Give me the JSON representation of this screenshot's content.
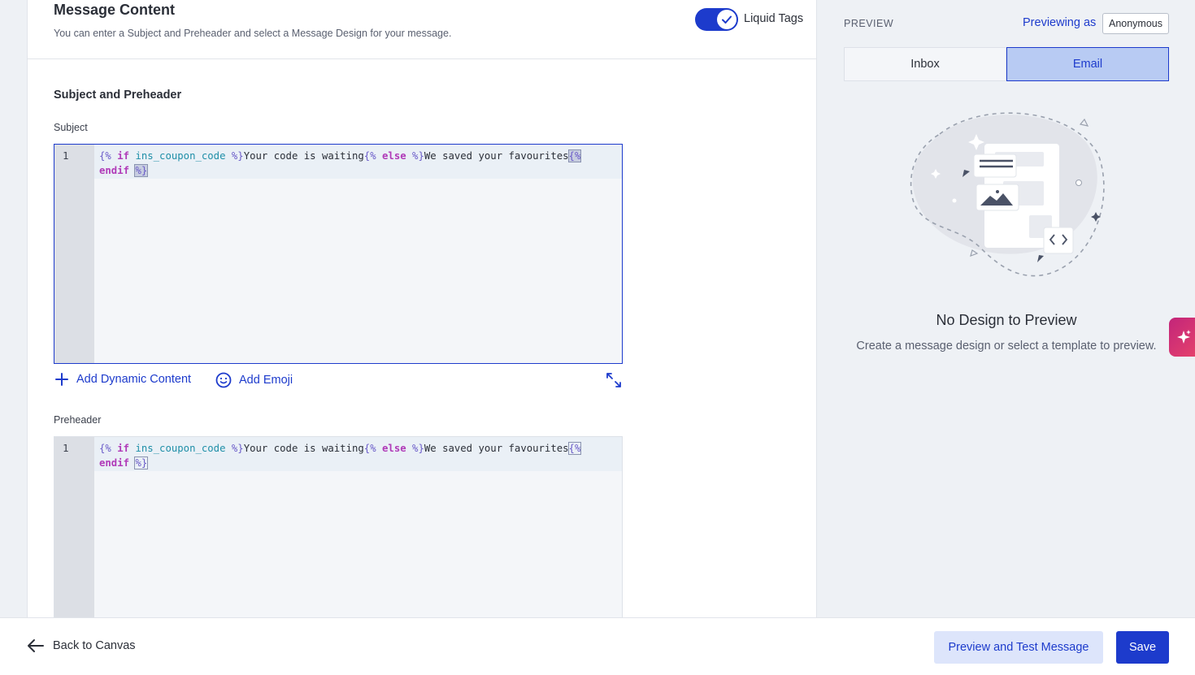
{
  "header": {
    "title": "Message Content",
    "subtitle": "You can enter a Subject and Preheader and select a Message Design for your message.",
    "liquid_toggle_label": "Liquid Tags",
    "liquid_toggle_on": true
  },
  "subject_section": {
    "title": "Subject and Preheader",
    "subject_label": "Subject",
    "preheader_label": "Preheader"
  },
  "code": {
    "line_number": "1",
    "open_if": "{%",
    "kw_if": "if",
    "var": "ins_coupon_code",
    "close": "%}",
    "text_a": "Your code is waiting",
    "open_else": "{%",
    "kw_else": "else",
    "close_else": "%}",
    "text_b": "We saved your favourites",
    "open_endif": "{%",
    "kw_endif": "endif",
    "close_endif": "%}"
  },
  "actions": {
    "add_dynamic": "Add Dynamic Content",
    "add_emoji": "Add Emoji"
  },
  "preview": {
    "heading": "PREVIEW",
    "previewing_as_label": "Previewing as",
    "persona": "Anonymous",
    "tabs": [
      "Inbox",
      "Email"
    ],
    "active_tab": "Email",
    "empty_title": "No Design to Preview",
    "empty_subtitle": "Create a message design or select a template to preview."
  },
  "footer": {
    "back_label": "Back to Canvas",
    "preview_test_label": "Preview and Test Message",
    "save_label": "Save"
  },
  "colors": {
    "accent": "#1d3bcc",
    "accent_light": "#b8cbf3",
    "ai_gradient_start": "#c2257a",
    "ai_gradient_end": "#e8436b"
  },
  "icons": {
    "toggle": "check-icon",
    "add_dynamic": "plus-icon",
    "add_emoji": "smiley-icon",
    "expand": "expand-icon",
    "back": "arrow-left-icon",
    "ai": "sparkle-icon"
  }
}
